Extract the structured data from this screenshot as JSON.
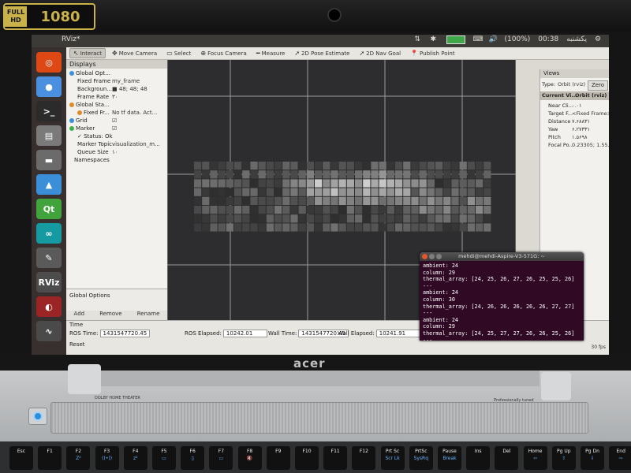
{
  "bezel": {
    "hd_full": "FULL HD",
    "hd_1080": "1080"
  },
  "laptop": {
    "brand": "acer",
    "dolby": "DOLBY HOME THEATER",
    "pro_sound": "Professionally tuned"
  },
  "topbar": {
    "title": "RViz*",
    "battery": "(100%)",
    "clock": "00:38",
    "day": "یکشنبه"
  },
  "launcher": {
    "items": [
      {
        "name": "ubuntu-icon",
        "label": "◎",
        "color": "#dd4814"
      },
      {
        "name": "chrome-icon",
        "label": "●",
        "color": "#4a8fe0"
      },
      {
        "name": "terminal-icon",
        "label": ">_",
        "color": "#2b2b2b"
      },
      {
        "name": "files-icon",
        "label": "▤",
        "color": "#7a7a7a"
      },
      {
        "name": "drive-icon",
        "label": "▬",
        "color": "#6b6b6b"
      },
      {
        "name": "qtcreator-icon",
        "label": "▲",
        "color": "#3a8fd8"
      },
      {
        "name": "qt-icon",
        "label": "Qt",
        "color": "#41a33b"
      },
      {
        "name": "arduino-icon",
        "label": "∞",
        "color": "#149aa0"
      },
      {
        "name": "editor-icon",
        "label": "✎",
        "color": "#5a5a5a"
      },
      {
        "name": "rviz-icon",
        "label": "RViz",
        "color": "#4c4c4c"
      },
      {
        "name": "rqt-icon",
        "label": "◐",
        "color": "#9b2525"
      },
      {
        "name": "monitor-icon",
        "label": "∿",
        "color": "#4a4a4a"
      }
    ]
  },
  "toolbar": {
    "items": [
      {
        "name": "interact-tool",
        "label": "Interact",
        "icon": "↖",
        "active": true
      },
      {
        "name": "move-camera-tool",
        "label": "Move Camera",
        "icon": "✥",
        "active": false
      },
      {
        "name": "select-tool",
        "label": "Select",
        "icon": "▭",
        "active": false
      },
      {
        "name": "focus-camera-tool",
        "label": "Focus Camera",
        "icon": "⊕",
        "active": false
      },
      {
        "name": "measure-tool",
        "label": "Measure",
        "icon": "━",
        "active": false
      },
      {
        "name": "2d-pose-estimate-tool",
        "label": "2D Pose Estimate",
        "icon": "➚",
        "active": false
      },
      {
        "name": "2d-nav-goal-tool",
        "label": "2D Nav Goal",
        "icon": "➚",
        "active": false
      },
      {
        "name": "publish-point-tool",
        "label": "Publish Point",
        "icon": "📍",
        "active": false
      }
    ]
  },
  "displays": {
    "title": "Displays",
    "rows": [
      {
        "key": "Global Opt...",
        "value": "",
        "indent": 4,
        "dot": "#3c8fd8"
      },
      {
        "key": "Fixed Frame",
        "value": "my_frame",
        "indent": 14,
        "dot": ""
      },
      {
        "key": "Backgroun...",
        "value": "■ 48; 48; 48",
        "indent": 14,
        "dot": ""
      },
      {
        "key": "Frame Rate",
        "value": "۳۰",
        "indent": 14,
        "dot": ""
      },
      {
        "key": "Global Sta...",
        "value": "",
        "indent": 4,
        "dot": "#e08a2a"
      },
      {
        "key": "Fixed Fr...",
        "value": "No tf data. Act...",
        "indent": 14,
        "dot": "#e08a2a"
      },
      {
        "key": "Grid",
        "value": "☑",
        "indent": 4,
        "dot": "#3c8fd8"
      },
      {
        "key": "Marker",
        "value": "☑",
        "indent": 4,
        "dot": "#3cb04a"
      },
      {
        "key": "✓ Status: Ok",
        "value": "",
        "indent": 14,
        "dot": ""
      },
      {
        "key": "Marker Topic",
        "value": "visualization_m...",
        "indent": 14,
        "dot": ""
      },
      {
        "key": "Queue Size",
        "value": "۱۰",
        "indent": 14,
        "dot": ""
      },
      {
        "key": "Namespaces",
        "value": "",
        "indent": 10,
        "dot": ""
      }
    ],
    "global_options_label": "Global Options",
    "buttons": {
      "add": "Add",
      "remove": "Remove",
      "rename": "Rename"
    }
  },
  "views": {
    "title": "Views",
    "type_label": "Type:",
    "type_value": "Orbit (rviz)",
    "zero": "Zero",
    "current_label": "Current Vi...",
    "current_value": "Orbit (rviz)",
    "rows": [
      {
        "key": "Near Cli...",
        "value": "۰.۰۱"
      },
      {
        "key": "Target F...",
        "value": "<Fixed Frame>"
      },
      {
        "key": "Distance",
        "value": "۷.۶۸۸۳۱"
      },
      {
        "key": "Yaw",
        "value": "۶.۲۷۳۳۱"
      },
      {
        "key": "Pitch",
        "value": "۱.۵۶۹۸"
      },
      {
        "key": "Focal Po...",
        "value": "0.23305; 1.55..."
      }
    ]
  },
  "time": {
    "title": "Time",
    "ros_time_label": "ROS Time:",
    "ros_time": "1431547720.45",
    "ros_elapsed_label": "ROS Elapsed:",
    "ros_elapsed": "10242.01",
    "wall_time_label": "Wall Time:",
    "wall_time": "1431547720.49",
    "wall_elapsed_label": "Wall Elapsed:",
    "wall_elapsed": "10241.91",
    "reset": "Reset",
    "fps": "30 fps"
  },
  "terminal": {
    "title": "mehdi@mehdi-Aspire-V3-571G: ~",
    "lines": [
      "ambient: 24",
      "column: 29",
      "thermal_array: [24, 25, 26, 27, 26, 25, 25, 26]",
      "---",
      "ambient: 24",
      "column: 30",
      "thermal_array: [24, 26, 26, 26, 26, 26, 27, 27]",
      "---",
      "ambient: 24",
      "column: 29",
      "thermal_array: [24, 25, 27, 27, 26, 26, 25, 26]",
      "---"
    ]
  },
  "keyboard": {
    "keys": [
      {
        "l": "Esc",
        "s": ""
      },
      {
        "l": "F1",
        "s": ""
      },
      {
        "l": "F2",
        "s": "Z²"
      },
      {
        "l": "F3",
        "s": "((•))"
      },
      {
        "l": "F4",
        "s": "z²"
      },
      {
        "l": "F5",
        "s": "▭"
      },
      {
        "l": "F6",
        "s": "▯"
      },
      {
        "l": "F7",
        "s": "▭"
      },
      {
        "l": "F8",
        "s": "🔇"
      },
      {
        "l": "F9",
        "s": ""
      },
      {
        "l": "F10",
        "s": ""
      },
      {
        "l": "F11",
        "s": ""
      },
      {
        "l": "F12",
        "s": ""
      },
      {
        "l": "Prt Sc",
        "s": "Scr Lk"
      },
      {
        "l": "PrtSc",
        "s": "SysRq"
      },
      {
        "l": "Pause",
        "s": "Break"
      },
      {
        "l": "Ins",
        "s": ""
      },
      {
        "l": "Del",
        "s": ""
      },
      {
        "l": "Home",
        "s": "⇦"
      },
      {
        "l": "Pg Up",
        "s": "⇧"
      },
      {
        "l": "Pg Dn",
        "s": "⇩"
      },
      {
        "l": "End",
        "s": "⇨"
      }
    ]
  },
  "colors": {
    "view_bg": "#2d2d2f",
    "grid_line": "#9a9a9a",
    "terminal_bg": "#300a24"
  }
}
